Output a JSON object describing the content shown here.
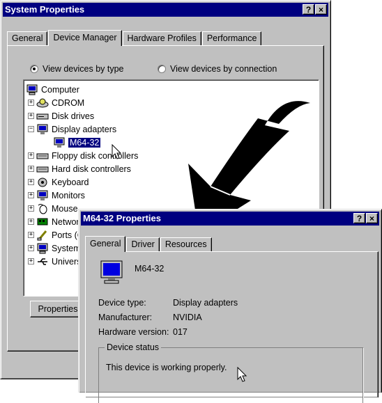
{
  "system_properties": {
    "title": "System Properties",
    "help_btn": "?",
    "close_btn": "×",
    "tabs": [
      "General",
      "Device Manager",
      "Hardware Profiles",
      "Performance"
    ],
    "radio_by_type": "View devices by type",
    "radio_by_connection": "View devices by connection",
    "tree": {
      "root": "Computer",
      "items": [
        "CDROM",
        "Disk drives",
        "Display adapters",
        "M64-32",
        "Floppy disk controllers",
        "Hard disk controllers",
        "Keyboard",
        "Monitors",
        "Mouse",
        "Network adapters",
        "Ports (COM & LPT)",
        "System devices",
        "Universal serial bus controller"
      ]
    },
    "properties_button": "Properties"
  },
  "m64_properties": {
    "title": "M64-32 Properties",
    "help_btn": "?",
    "close_btn": "×",
    "tabs": [
      "General",
      "Driver",
      "Resources"
    ],
    "device_name": "M64-32",
    "device_type_label": "Device type:",
    "device_type_value": "Display adapters",
    "manufacturer_label": "Manufacturer:",
    "manufacturer_value": "NVIDIA",
    "hardware_version_label": "Hardware version:",
    "hardware_version_value": "017",
    "device_status_label": "Device status",
    "device_status_text": "This device is working properly."
  },
  "icons": [
    "computer-icon",
    "cdrom-icon",
    "disk-icon",
    "monitor-icon",
    "controller-icon",
    "keyboard-icon",
    "mouse-icon",
    "network-icon",
    "port-icon",
    "usb-icon",
    "arrow-icon",
    "cursor-icon"
  ],
  "colors": {
    "titlebar": "#000080",
    "face": "#c0c0c0",
    "selection": "#000080"
  }
}
